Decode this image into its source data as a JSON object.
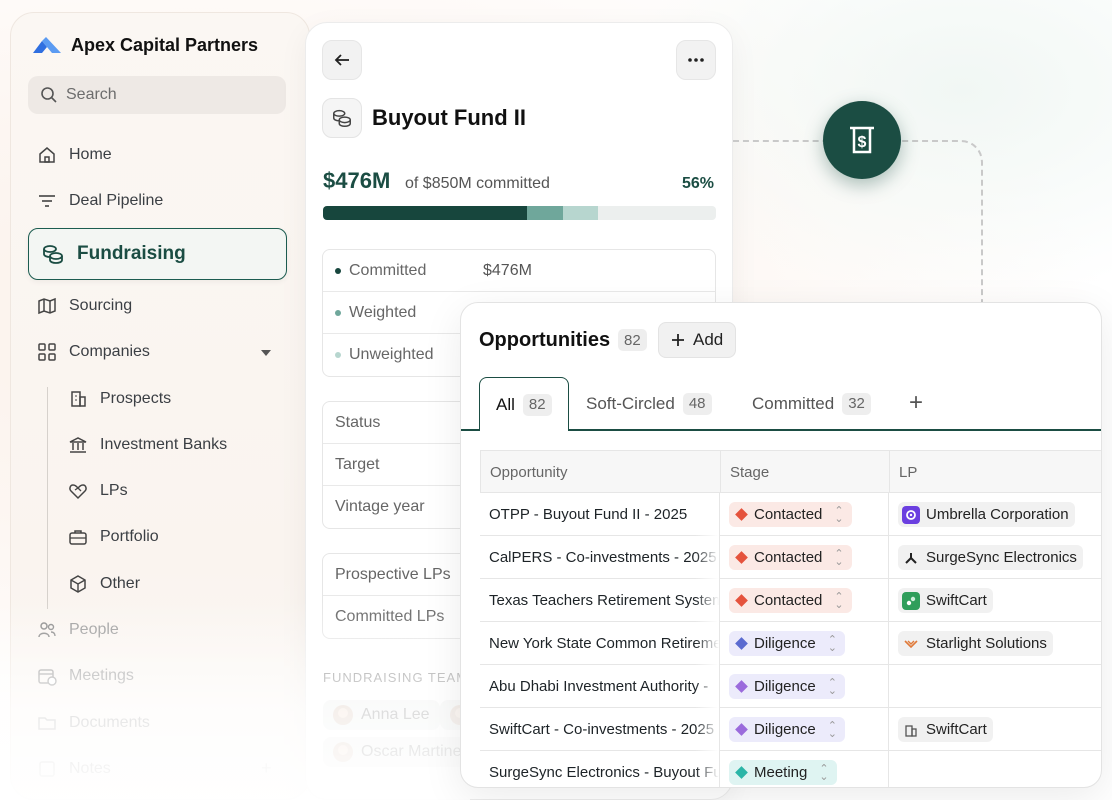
{
  "brand": {
    "name": "Apex Capital Partners"
  },
  "search": {
    "placeholder": "Search"
  },
  "nav": {
    "home": "Home",
    "deal_pipeline": "Deal Pipeline",
    "fundraising": "Fundraising",
    "sourcing": "Sourcing",
    "companies": "Companies",
    "prospects": "Prospects",
    "investment_banks": "Investment Banks",
    "lps": "LPs",
    "portfolio": "Portfolio",
    "other": "Other",
    "people": "People",
    "meetings": "Meetings",
    "documents": "Documents",
    "notes": "Notes"
  },
  "fund": {
    "title": "Buyout Fund II",
    "amount": "$476M",
    "committed_text": "of $850M committed",
    "percent_label": "56%",
    "progress": {
      "committed": 0.52,
      "weighted": 0.09,
      "unweighted": 0.09
    },
    "stats": [
      {
        "label": "Committed",
        "value": "$476M",
        "dot": "#17463d"
      },
      {
        "label": "Weighted",
        "value": "",
        "dot": "#6fa79b"
      },
      {
        "label": "Unweighted",
        "value": "",
        "dot": "#b7d6cf"
      }
    ],
    "details": [
      {
        "label": "Status"
      },
      {
        "label": "Target"
      },
      {
        "label": "Vintage year"
      }
    ],
    "lp_rows": [
      {
        "label": "Prospective LPs"
      },
      {
        "label": "Committed LPs"
      }
    ],
    "team_label": "FUNDRAISING TEAM",
    "team": [
      "Anna Lee",
      "Oscar Martinez"
    ]
  },
  "opportunities": {
    "title": "Opportunities",
    "count": "82",
    "add_label": "Add",
    "tabs": [
      {
        "label": "All",
        "count": "82"
      },
      {
        "label": "Soft-Circled",
        "count": "48"
      },
      {
        "label": "Committed",
        "count": "32"
      }
    ],
    "columns": [
      "Opportunity",
      "Stage",
      "LP"
    ],
    "rows": [
      {
        "name": "OTPP - Buyout Fund II - 2025",
        "stage": "Contacted",
        "lp": "Umbrella Corporation"
      },
      {
        "name": "CalPERS - Co-investments - 2025",
        "stage": "Contacted",
        "lp": "SurgeSync Electronics"
      },
      {
        "name": "Texas Teachers Retirement System",
        "stage": "Contacted",
        "lp": "SwiftCart"
      },
      {
        "name": "New York State Common Retirement",
        "stage": "Diligence",
        "lp": "Starlight Solutions"
      },
      {
        "name": "Abu Dhabi Investment Authority -",
        "stage": "Diligence",
        "lp": ""
      },
      {
        "name": "SwiftCart - Co-investments - 2025",
        "stage": "Diligence",
        "lp": "SwiftCart"
      },
      {
        "name": "SurgeSync Electronics - Buyout Fund",
        "stage": "Meeting",
        "lp": ""
      }
    ]
  },
  "colors": {
    "accent": "#1b4d43",
    "contacted": "#e5533d",
    "diligence_blue": "#5b6bd0",
    "diligence_purple": "#9b6bdc",
    "meeting": "#2bb5a7"
  }
}
